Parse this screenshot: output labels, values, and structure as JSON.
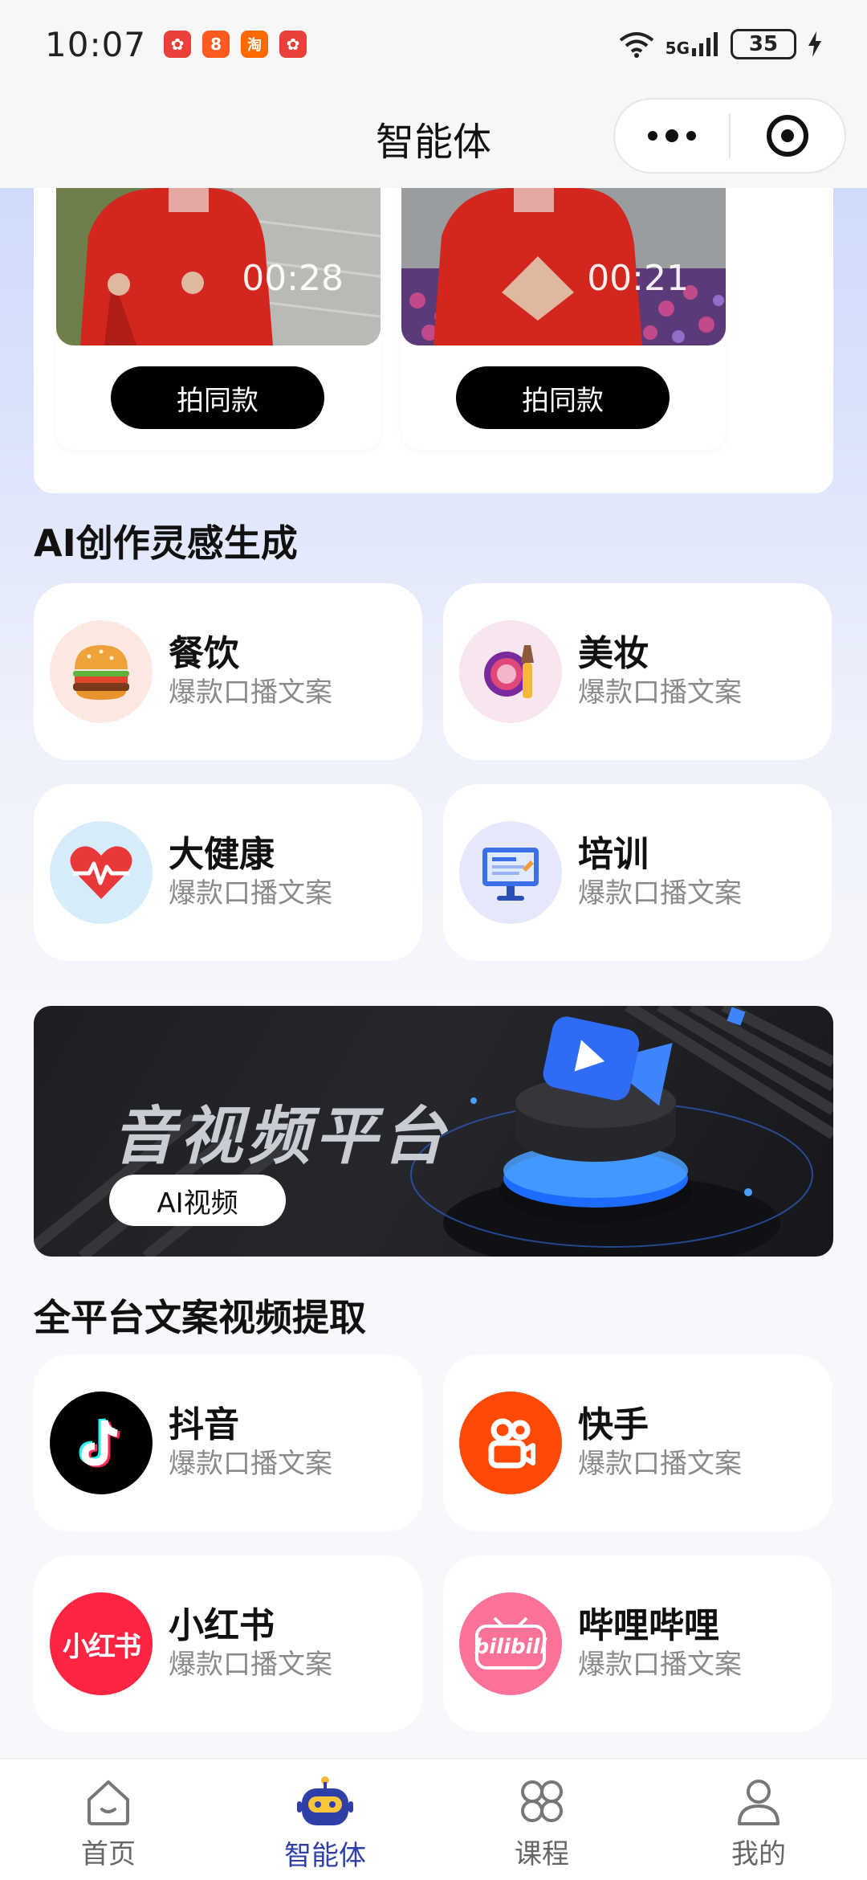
{
  "status_bar": {
    "time": "10:07",
    "network": "5G",
    "battery": "35",
    "notifications": [
      {
        "name": "huawei-app-icon",
        "color": "#e8403a",
        "glyph": "✿"
      },
      {
        "name": "kuaishou-app-icon",
        "color": "#ff5a1f",
        "glyph": "8"
      },
      {
        "name": "taobao-app-icon",
        "color": "#ff6a00",
        "glyph": "淘"
      },
      {
        "name": "huawei-app-icon-2",
        "color": "#e8403a",
        "glyph": "✿"
      }
    ]
  },
  "nav": {
    "title": "智能体",
    "more_icon": "more-dots-icon",
    "close_icon": "target-circle-icon"
  },
  "templates": [
    {
      "duration": "00:28",
      "button": "拍同款"
    },
    {
      "duration": "00:21",
      "button": "拍同款"
    }
  ],
  "sections": {
    "ai_inspiration": "AI创作灵感生成",
    "platform_extract": "全平台文案视频提取"
  },
  "categories": [
    {
      "name": "餐饮",
      "sub": "爆款口播文案",
      "icon": "burger-icon"
    },
    {
      "name": "美妆",
      "sub": "爆款口播文案",
      "icon": "makeup-icon"
    },
    {
      "name": "大健康",
      "sub": "爆款口播文案",
      "icon": "heart-pulse-icon"
    },
    {
      "name": "培训",
      "sub": "爆款口播文案",
      "icon": "presentation-screen-icon"
    }
  ],
  "banner": {
    "title": "音视频平台",
    "pill": "AI视频"
  },
  "platforms": [
    {
      "name": "抖音",
      "sub": "爆款口播文案",
      "icon": "douyin-icon",
      "color": "#000000"
    },
    {
      "name": "快手",
      "sub": "爆款口播文案",
      "icon": "kuaishou-icon",
      "color": "#ff4906"
    },
    {
      "name": "小红书",
      "sub": "爆款口播文案",
      "icon": "xiaohongshu-icon",
      "color": "#ff2442",
      "logo_text": "小红书"
    },
    {
      "name": "哔哩哔哩",
      "sub": "爆款口播文案",
      "icon": "bilibili-icon",
      "color": "#fb7299",
      "logo_text": "bilibili"
    }
  ],
  "tabs": [
    {
      "label": "首页",
      "icon": "home-icon",
      "active": false
    },
    {
      "label": "智能体",
      "icon": "robot-icon",
      "active": true
    },
    {
      "label": "课程",
      "icon": "course-grid-icon",
      "active": false
    },
    {
      "label": "我的",
      "icon": "profile-icon",
      "active": false
    }
  ],
  "colors": {
    "accent": "#2e3fa8",
    "button_bg": "#000000",
    "subtext": "#8a8a8a"
  }
}
